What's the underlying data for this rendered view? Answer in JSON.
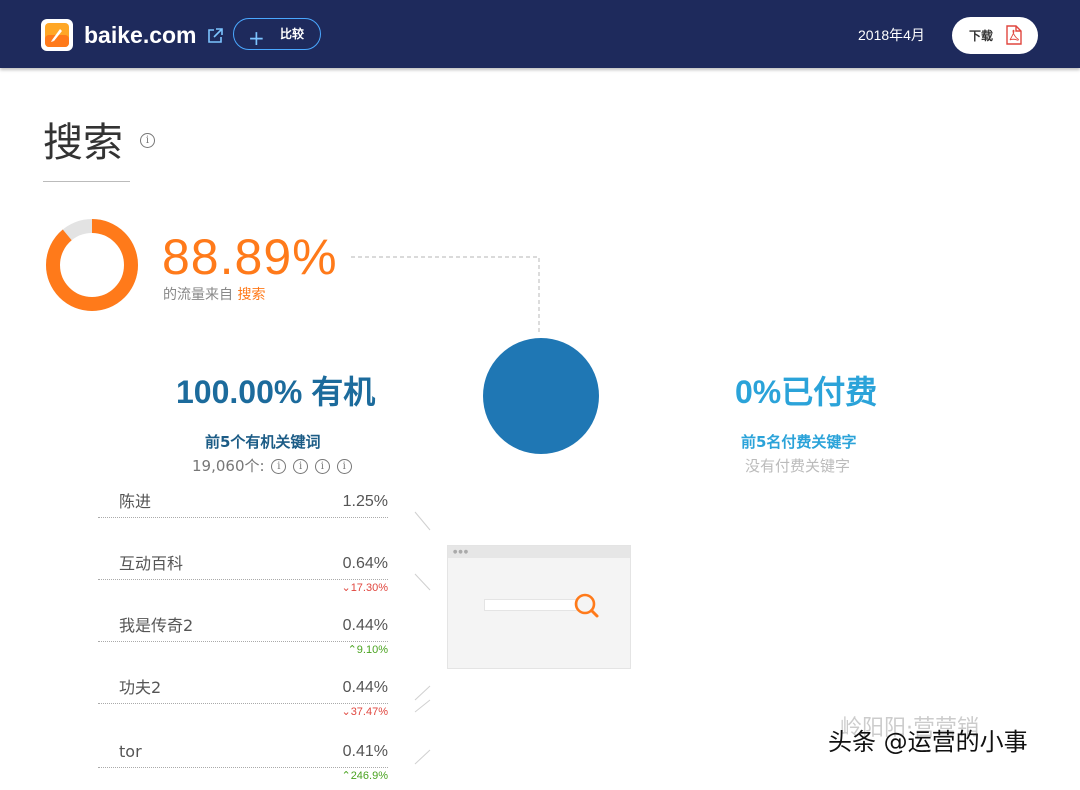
{
  "header": {
    "site_name": "baike.com",
    "compare_label": "比较",
    "plus_glyph": "+",
    "date": "2018年4月",
    "download_label": "下载",
    "background_color": "#1e2a5c"
  },
  "search_section": {
    "title": "搜索",
    "info_glyph": "i",
    "traffic_share_pct": 88.89,
    "traffic_share_text": "88.89%",
    "traffic_prefix": "的流量来自",
    "traffic_source": "搜索",
    "accent_color": "#ff7a1a"
  },
  "organic": {
    "title": "100.00% 有机",
    "share_pct": 100.0,
    "subtitle": "前5个有机关键词",
    "count_text": "19,060个:",
    "info_glyph": "i",
    "color": "#1f77b4"
  },
  "paid": {
    "title": "0%已付费",
    "share_pct": 0,
    "subtitle": "前5名付费关键字",
    "empty_text": "没有付费关键字",
    "color": "#2ba3d9"
  },
  "keywords": [
    {
      "name": "陈进",
      "share": "1.25%",
      "change": "",
      "direction": ""
    },
    {
      "name": "互动百科",
      "share": "0.64%",
      "change": "17.30%",
      "direction": "down"
    },
    {
      "name": "我是传奇2",
      "share": "0.44%",
      "change": "9.10%",
      "direction": "up"
    },
    {
      "name": "功夫2",
      "share": "0.44%",
      "change": "37.47%",
      "direction": "down"
    },
    {
      "name": "tor",
      "share": "0.41%",
      "change": "246.9%",
      "direction": "up"
    }
  ],
  "watermark": {
    "main": "头条 @运营的小事",
    "faint": "岭阳阳·营营销"
  }
}
